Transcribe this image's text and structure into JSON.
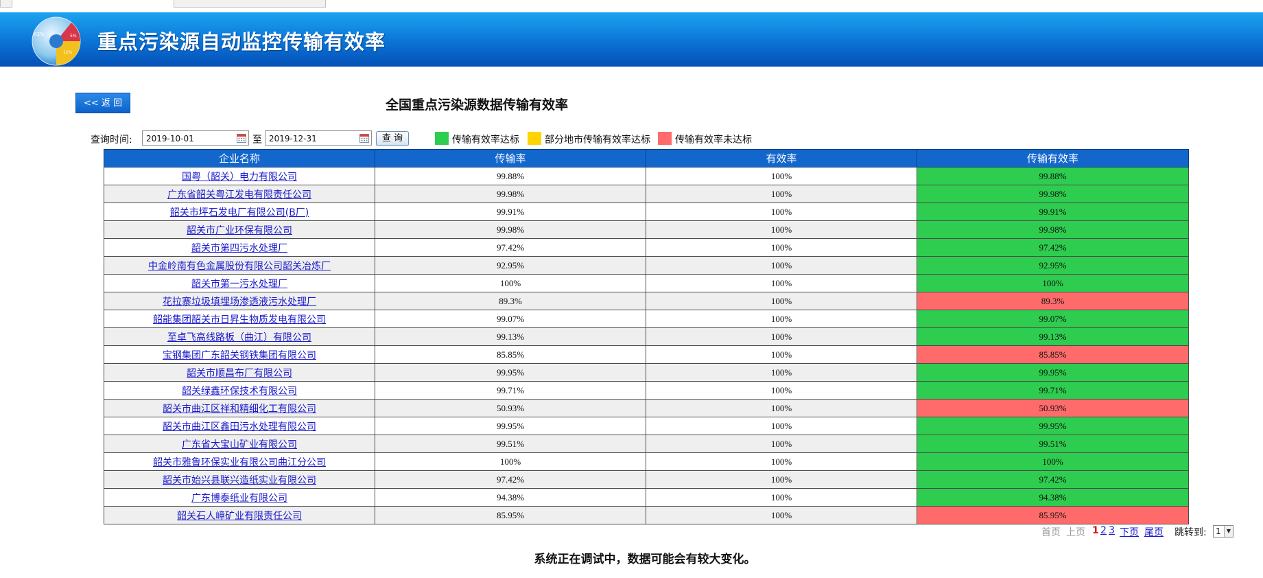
{
  "header": {
    "title": "重点污染源自动监控传输有效率",
    "logo_labels": [
      "83%",
      "5%",
      "12%"
    ]
  },
  "back_button": "<< 返 回",
  "page_title": "全国重点污染源数据传输有效率",
  "query": {
    "label": "查询时间:",
    "start_date": "2019-10-01",
    "to_label": "至",
    "end_date": "2019-12-31",
    "button": "查 询"
  },
  "legend": [
    {
      "label": "传输有效率达标",
      "color": "#2ecc4f"
    },
    {
      "label": "部分地市传输有效率达标",
      "color": "#ffd400"
    },
    {
      "label": "传输有效率未达标",
      "color": "#ff6b6b"
    }
  ],
  "table": {
    "headers": [
      "企业名称",
      "传输率",
      "有效率",
      "传输有效率"
    ],
    "rows": [
      {
        "name": "国粤（韶关）电力有限公司",
        "rate": "99.88%",
        "valid": "100%",
        "eff": "99.88%",
        "status": "good"
      },
      {
        "name": "广东省韶关粤江发电有限责任公司",
        "rate": "99.98%",
        "valid": "100%",
        "eff": "99.98%",
        "status": "good"
      },
      {
        "name": "韶关市坪石发电厂有限公司(B厂)",
        "rate": "99.91%",
        "valid": "100%",
        "eff": "99.91%",
        "status": "good"
      },
      {
        "name": "韶关市广业环保有限公司",
        "rate": "99.98%",
        "valid": "100%",
        "eff": "99.98%",
        "status": "good"
      },
      {
        "name": "韶关市第四污水处理厂",
        "rate": "97.42%",
        "valid": "100%",
        "eff": "97.42%",
        "status": "good"
      },
      {
        "name": "中金岭南有色金属股份有限公司韶关冶炼厂",
        "rate": "92.95%",
        "valid": "100%",
        "eff": "92.95%",
        "status": "good"
      },
      {
        "name": "韶关市第一污水处理厂",
        "rate": "100%",
        "valid": "100%",
        "eff": "100%",
        "status": "good"
      },
      {
        "name": "花拉寨垃圾填埋场渗透液污水处理厂",
        "rate": "89.3%",
        "valid": "100%",
        "eff": "89.3%",
        "status": "bad"
      },
      {
        "name": "韶能集团韶关市日昇生物质发电有限公司",
        "rate": "99.07%",
        "valid": "100%",
        "eff": "99.07%",
        "status": "good"
      },
      {
        "name": "至卓飞高线路板（曲江）有限公司",
        "rate": "99.13%",
        "valid": "100%",
        "eff": "99.13%",
        "status": "good"
      },
      {
        "name": "宝钢集团广东韶关钢铁集团有限公司",
        "rate": "85.85%",
        "valid": "100%",
        "eff": "85.85%",
        "status": "bad"
      },
      {
        "name": "韶关市顺昌布厂有限公司",
        "rate": "99.95%",
        "valid": "100%",
        "eff": "99.95%",
        "status": "good"
      },
      {
        "name": "韶关绿鑫环保技术有限公司",
        "rate": "99.71%",
        "valid": "100%",
        "eff": "99.71%",
        "status": "good"
      },
      {
        "name": "韶关市曲江区祥和精细化工有限公司",
        "rate": "50.93%",
        "valid": "100%",
        "eff": "50.93%",
        "status": "bad"
      },
      {
        "name": "韶关市曲江区鑫田污水处理有限公司",
        "rate": "99.95%",
        "valid": "100%",
        "eff": "99.95%",
        "status": "good"
      },
      {
        "name": "广东省大宝山矿业有限公司",
        "rate": "99.51%",
        "valid": "100%",
        "eff": "99.51%",
        "status": "good"
      },
      {
        "name": "韶关市雅鲁环保实业有限公司曲江分公司",
        "rate": "100%",
        "valid": "100%",
        "eff": "100%",
        "status": "good"
      },
      {
        "name": "韶关市始兴县联兴造纸实业有限公司",
        "rate": "97.42%",
        "valid": "100%",
        "eff": "97.42%",
        "status": "good"
      },
      {
        "name": "广东博泰纸业有限公司",
        "rate": "94.38%",
        "valid": "100%",
        "eff": "94.38%",
        "status": "good"
      },
      {
        "name": "韶关石人嶂矿业有限责任公司",
        "rate": "85.95%",
        "valid": "100%",
        "eff": "85.95%",
        "status": "bad"
      }
    ]
  },
  "pager": {
    "first": "首页",
    "prev": "上页",
    "pages": [
      "1",
      "2",
      "3"
    ],
    "current": "1",
    "next": "下页",
    "last": "尾页",
    "jump_label": "跳转到:",
    "jump_value": "1"
  },
  "notice": "系统正在调试中，数据可能会有较大变化。"
}
